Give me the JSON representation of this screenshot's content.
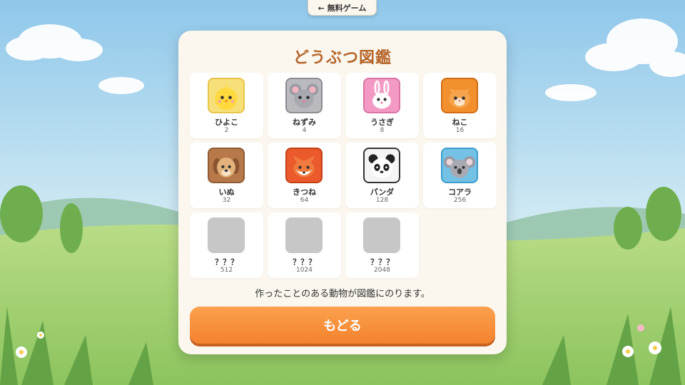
{
  "nav": {
    "back_label": "← 無料ゲーム"
  },
  "dialog": {
    "title": "どうぶつ図鑑",
    "note": "作ったことのある動物が図鑑にのります。",
    "return_label": "もどる"
  },
  "animals": [
    {
      "name": "ひよこ",
      "value": "2",
      "icon": "chick-icon",
      "color": "#f7e07a"
    },
    {
      "name": "ねずみ",
      "value": "4",
      "icon": "mouse-icon",
      "color": "#b9b9be"
    },
    {
      "name": "うさぎ",
      "value": "8",
      "icon": "rabbit-icon",
      "color": "#f29ac3"
    },
    {
      "name": "ねこ",
      "value": "16",
      "icon": "cat-icon",
      "color": "#f2902e"
    },
    {
      "name": "いぬ",
      "value": "32",
      "icon": "dog-icon",
      "color": "#b8794a"
    },
    {
      "name": "きつね",
      "value": "64",
      "icon": "fox-icon",
      "color": "#ea5a2c"
    },
    {
      "name": "パンダ",
      "value": "128",
      "icon": "panda-icon",
      "color": "#f4f4f4"
    },
    {
      "name": "コアラ",
      "value": "256",
      "icon": "koala-icon",
      "color": "#73c2e6"
    },
    {
      "name": "？？？",
      "value": "512",
      "icon": "locked-icon",
      "color": "#c7c7c7"
    },
    {
      "name": "？？？",
      "value": "1024",
      "icon": "locked-icon",
      "color": "#c7c7c7"
    },
    {
      "name": "？？？",
      "value": "2048",
      "icon": "locked-icon",
      "color": "#c7c7c7"
    }
  ],
  "colors": {
    "title": "#b5652a",
    "button": "#f4822c",
    "panel": "#fbf7ee"
  }
}
